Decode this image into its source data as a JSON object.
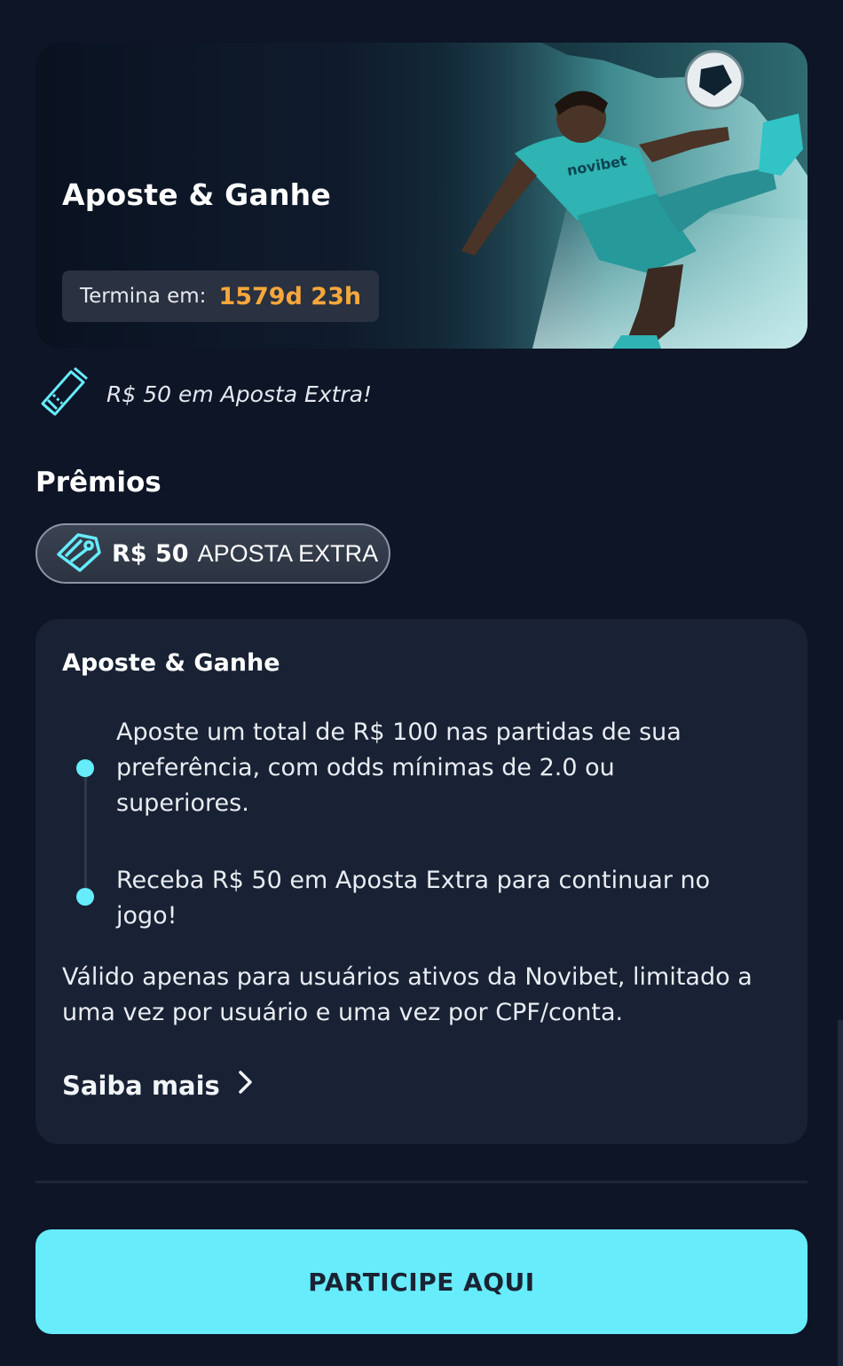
{
  "colors": {
    "background": "#0d1526",
    "card": "#182234",
    "accent": "#67ecfb",
    "countdown": "#f7a73b"
  },
  "hero": {
    "title": "Aposte & Ganhe",
    "countdown_label": "Termina em:",
    "countdown_value": "1579d 23h",
    "image": "soccer-player-kick-illustration",
    "jersey_logo": "novibet"
  },
  "extra": {
    "icon": "ticket-icon",
    "text": "R$ 50 em Aposta Extra!"
  },
  "prizes": {
    "title": "Prêmios",
    "chip_icon": "voucher-tag-icon",
    "chip_amount": "R$ 50",
    "chip_label": "APOSTA EXTRA"
  },
  "card": {
    "title": "Aposte & Ganhe",
    "steps": [
      "Aposte um total de R$ 100 nas partidas de sua preferência, com odds mínimas de 2.0 ou superiores.",
      "Receba R$ 50 em Aposta Extra para continuar no jogo!"
    ],
    "valid_text": "Válido apenas para usuários ativos da Novibet, limitado a uma vez por usuário e uma vez por CPF/conta.",
    "learn_more": "Saiba mais",
    "learn_more_icon": "chevron-right-icon"
  },
  "cta": {
    "label": "PARTICIPE AQUI"
  }
}
